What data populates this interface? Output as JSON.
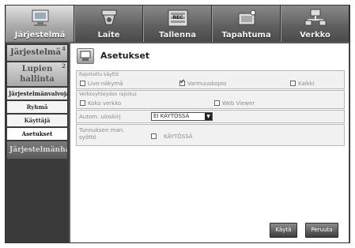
{
  "nav": {
    "tabs": [
      {
        "label": "Järjestelmä",
        "icon": "system-monitor-icon"
      },
      {
        "label": "Laite",
        "icon": "camera-device-icon"
      },
      {
        "label": "Tallenna",
        "icon": "rec-icon"
      },
      {
        "label": "Tapahtuma",
        "icon": "event-icon"
      },
      {
        "label": "Verkko",
        "icon": "network-icon"
      }
    ]
  },
  "sidebar": {
    "system": {
      "label": "Järjestelmä",
      "badge": "4"
    },
    "permissions": {
      "label1": "Lupien",
      "label2": "hallinta",
      "badge": "2"
    },
    "user_monitoring": "Järjestelmänvalvoja",
    "items": [
      "Ryhmä",
      "Käyttäjä",
      "Asetukset"
    ],
    "system_bottom": "Järjestelmänhallinta"
  },
  "page": {
    "title": "Asetukset"
  },
  "restricted_use": {
    "title": "Rajoitettu käyttö",
    "options": [
      {
        "label": "Live-näkymä",
        "checked": false
      },
      {
        "label": "Varmuuskopio",
        "checked": true
      },
      {
        "label": "Kaikki",
        "checked": false
      }
    ]
  },
  "network_restriction": {
    "title": "Verkkoyhteyden rajoitus",
    "options": [
      {
        "label": "Koko verkko",
        "checked": false
      },
      {
        "label": "Web Viewer",
        "checked": false
      }
    ]
  },
  "auto_logout": {
    "label": "Autom. uloskirj",
    "value": "EI KÄYTÖSSÄ"
  },
  "id_input": {
    "label": "Tunnuksen man. syöttö",
    "checkbox_label": "KÄYTÖSSÄ",
    "checked": false
  },
  "buttons": {
    "apply": "Käytä",
    "cancel": "Peruuta"
  }
}
